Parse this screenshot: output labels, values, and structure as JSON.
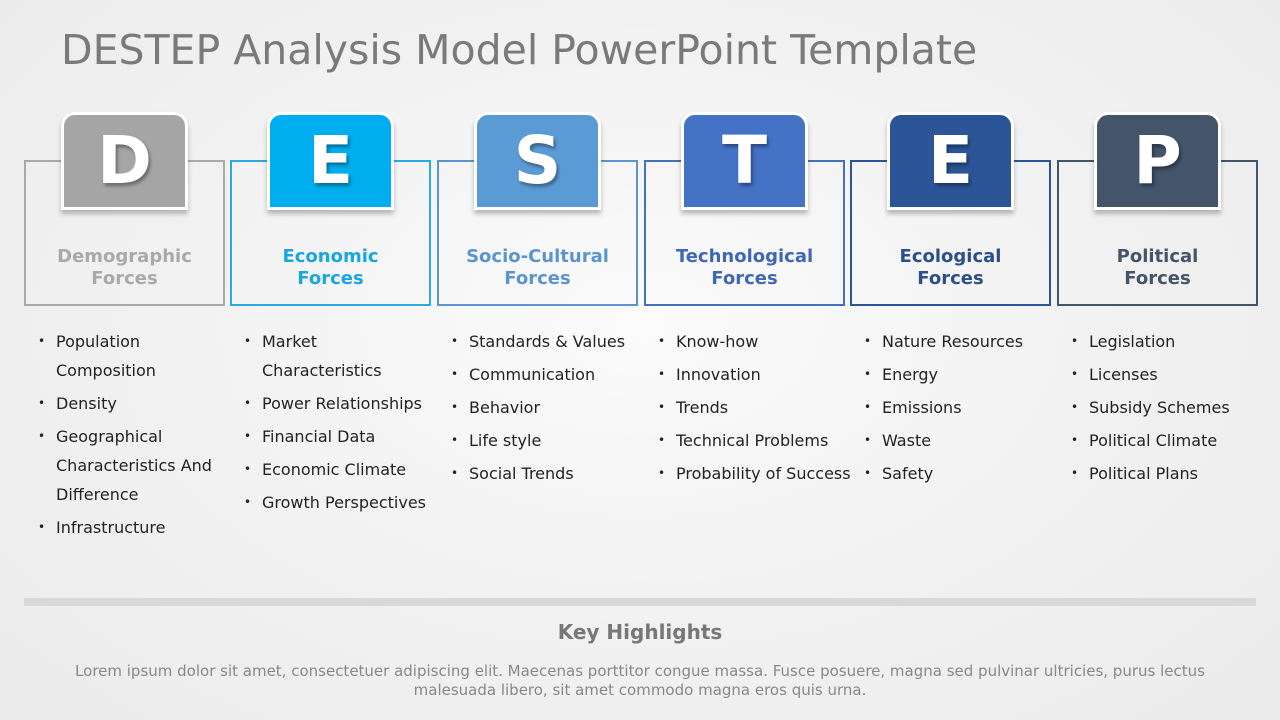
{
  "title": "DESTEP Analysis Model PowerPoint Template",
  "columns": [
    {
      "letter": "D",
      "heading_line1": "Demographic",
      "heading_line2": "Forces",
      "color": "#a5a5a5",
      "heading_color": "#a9a9a9",
      "border_color": "#a9a9a9",
      "items": [
        "Population Composition",
        "Density",
        "Geographical Characteristics And Difference",
        "Infrastructure"
      ]
    },
    {
      "letter": "E",
      "heading_line1": "Economic",
      "heading_line2": "Forces",
      "color": "#00adee",
      "heading_color": "#1aa7e0",
      "border_color": "#2aaae0",
      "items": [
        "Market Characteristics",
        "Power Relationships",
        "Financial Data",
        "Economic Climate",
        "Growth Perspectives"
      ]
    },
    {
      "letter": "S",
      "heading_line1": "Socio-Cultural",
      "heading_line2": "Forces",
      "color": "#5b9bd5",
      "heading_color": "#5b95cf",
      "border_color": "#5b95cf",
      "items": [
        "Standards & Values",
        "Communication",
        "Behavior",
        "Life style",
        "Social Trends"
      ]
    },
    {
      "letter": "T",
      "heading_line1": "Technological",
      "heading_line2": "Forces",
      "color": "#4472c4",
      "heading_color": "#3f67b3",
      "border_color": "#4570bf",
      "items": [
        "Know-how",
        "Innovation",
        "Trends",
        "Technical Problems",
        "Probability of Success"
      ]
    },
    {
      "letter": "E",
      "heading_line1": "Ecological",
      "heading_line2": "Forces",
      "color": "#2c5597",
      "heading_color": "#2a4f8a",
      "border_color": "#2c5597",
      "items": [
        "Nature Resources",
        "Energy",
        "Emissions",
        "Waste",
        "Safety"
      ]
    },
    {
      "letter": "P",
      "heading_line1": "Political",
      "heading_line2": "Forces",
      "color": "#44546a",
      "heading_color": "#44546a",
      "border_color": "#44546a",
      "items": [
        "Legislation",
        "Licenses",
        "Subsidy Schemes",
        "Political Climate",
        "Political Plans"
      ]
    }
  ],
  "bullet_glyph": "•",
  "key_highlights": {
    "title": "Key Highlights",
    "body": "Lorem ipsum dolor sit amet, consectetuer adipiscing elit. Maecenas porttitor congue massa. Fusce posuere, magna sed pulvinar ultricies, purus lectus malesuada libero, sit amet commodo magna eros quis urna."
  }
}
